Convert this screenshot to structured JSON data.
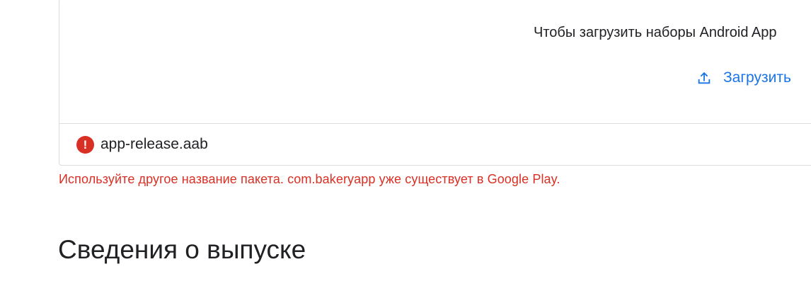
{
  "upload": {
    "instruction_text": "Чтобы загрузить наборы Android App",
    "upload_button_label": "Загрузить",
    "upload_icon": "upload-icon",
    "accent_color": "#1a73e8"
  },
  "file": {
    "name": "app-release.aab",
    "status_icon": "error-icon",
    "status": "error"
  },
  "error": {
    "message": "Используйте другое название пакета. com.bakeryapp уже существует в Google Play.",
    "color": "#d93025"
  },
  "section": {
    "title": "Сведения о выпуске"
  }
}
